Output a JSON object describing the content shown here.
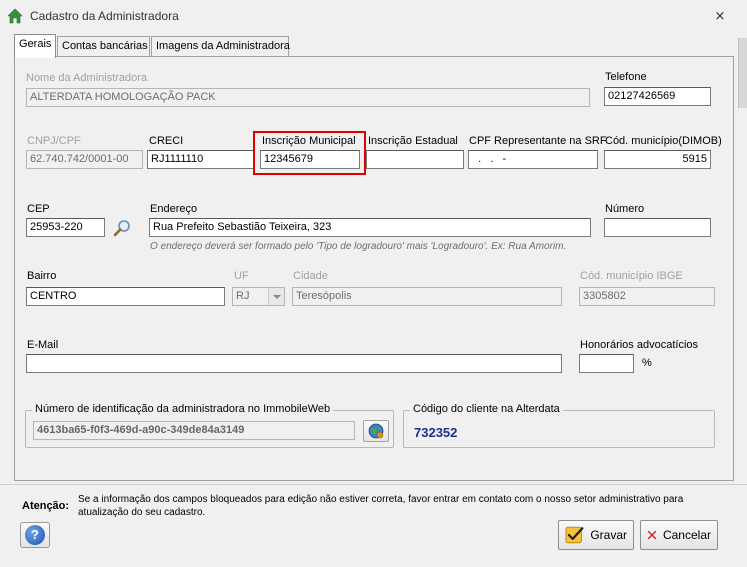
{
  "window": {
    "title": "Cadastro da Administradora",
    "close_symbol": "⨯"
  },
  "tabs": [
    {
      "label": "Gerais"
    },
    {
      "label": "Contas bancárias"
    },
    {
      "label": "Imagens da Administradora"
    }
  ],
  "form": {
    "nome": {
      "label": "Nome da Administradora",
      "value": "ALTERDATA HOMOLOGAÇÃO PACK"
    },
    "telefone": {
      "label": "Telefone",
      "value": "02127426569"
    },
    "cnpj": {
      "label": "CNPJ/CPF",
      "value": "62.740.742/0001-00"
    },
    "creci": {
      "label": "CRECI",
      "value": "RJ1111110"
    },
    "inscricao_municipal": {
      "label": "Inscrição Municipal",
      "value": "12345679"
    },
    "inscricao_estadual": {
      "label": "Inscrição Estadual",
      "value": ""
    },
    "cpf_representante": {
      "label": "CPF Representante na SRF",
      "value": "  .   .   -"
    },
    "cod_municipio_dimob": {
      "label": "Cód. município(DIMOB)",
      "value": "5915"
    },
    "cep": {
      "label": "CEP",
      "value": "25953-220"
    },
    "endereco": {
      "label": "Endereço",
      "value": "Rua Prefeito Sebastião Teixeira, 323",
      "hint": "O endereço deverá ser formado pelo 'Tipo de logradouro' mais 'Logradouro'. Ex: Rua Amorim."
    },
    "numero": {
      "label": "Número",
      "value": ""
    },
    "bairro": {
      "label": "Bairro",
      "value": "CENTRO"
    },
    "uf": {
      "label": "UF",
      "value": "RJ"
    },
    "cidade": {
      "label": "Cidade",
      "value": "Teresópolis"
    },
    "cod_municipio_ibge": {
      "label": "Cód. município IBGE",
      "value": "3305802"
    },
    "email": {
      "label": "E-Mail",
      "value": ""
    },
    "honorarios": {
      "label": "Honorários advocatícios",
      "value": "",
      "unit": "%"
    },
    "immobile": {
      "label": "Número de identificação da administradora no ImmobileWeb",
      "value": "4613ba65-f0f3-469d-a90c-349de84a3149"
    },
    "codigo_cliente": {
      "label": "Código do cliente na Alterdata",
      "value": "732352"
    }
  },
  "footer": {
    "attention_title": "Atenção:",
    "attention_text": "Se a informação dos campos bloqueados para edição não estiver correta, favor entrar em contato com o nosso setor administrativo para atualização do seu cadastro.",
    "help_label": "?",
    "save_label": "Gravar",
    "cancel_label": "Cancelar"
  },
  "colors": {
    "highlight": "#e10000",
    "client_code": "#1f2f8f"
  }
}
